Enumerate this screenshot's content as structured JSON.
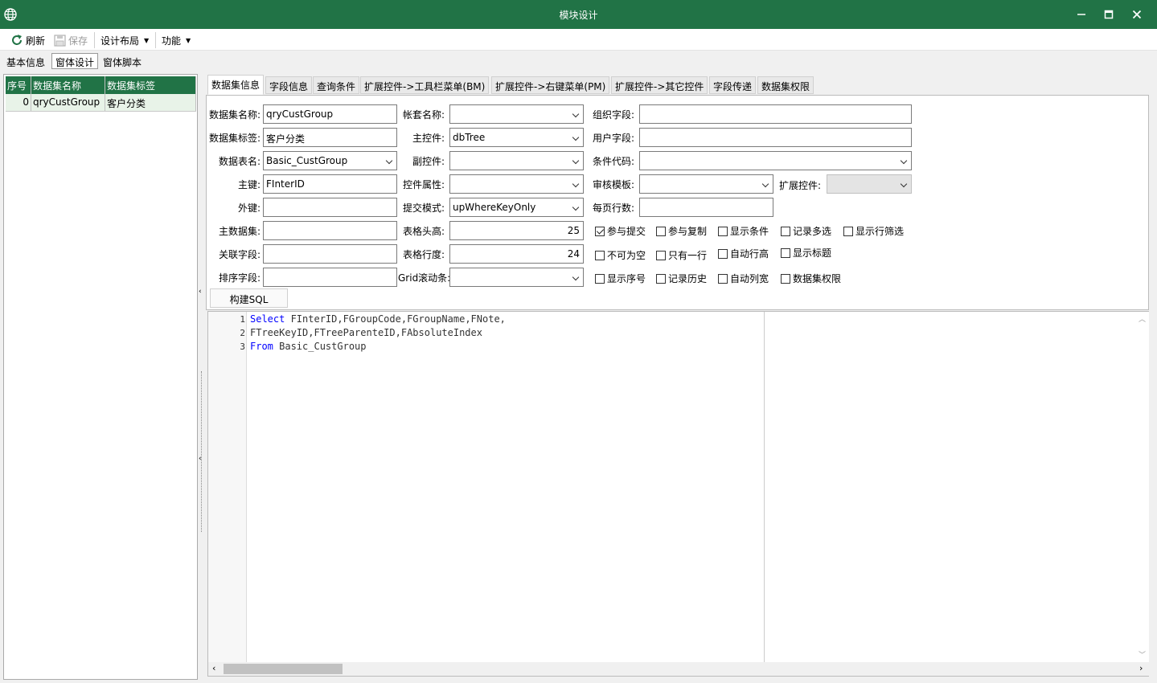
{
  "window": {
    "title": "模块设计",
    "accent": "#217346"
  },
  "toolbar": {
    "refresh": "刷新",
    "save": "保存",
    "layout": "设计布局",
    "functions": "功能"
  },
  "top_tabs": [
    "基本信息",
    "窗体设计",
    "窗体脚本"
  ],
  "left_grid": {
    "headers": [
      "序号",
      "数据集名称",
      "数据集标签"
    ],
    "rows": [
      {
        "idx": "0",
        "name": "qryCustGroup",
        "label": "客户分类"
      }
    ]
  },
  "right_tabs": [
    "数据集信息",
    "字段信息",
    "查询条件",
    "扩展控件->工具栏菜单(BM)",
    "扩展控件->右键菜单(PM)",
    "扩展控件->其它控件",
    "字段传递",
    "数据集权限"
  ],
  "form": {
    "col1": {
      "name_label": "数据集名称:",
      "name_value": "qryCustGroup",
      "tag_label": "数据集标签:",
      "tag_value": "客户分类",
      "table_label": "数据表名:",
      "table_value": "Basic_CustGroup",
      "pk_label": "主键:",
      "pk_value": "FInterID",
      "fk_label": "外键:",
      "fk_value": "",
      "master_label": "主数据集:",
      "master_value": "",
      "link_label": "关联字段:",
      "link_value": "",
      "sort_label": "排序字段:",
      "sort_value": ""
    },
    "col2": {
      "account_label": "帐套名称:",
      "account_value": "",
      "main_ctrl_label": "主控件:",
      "main_ctrl_value": "dbTree",
      "sub_ctrl_label": "副控件:",
      "sub_ctrl_value": "",
      "ctrl_prop_label": "控件属性:",
      "ctrl_prop_value": "",
      "submit_label": "提交模式:",
      "submit_value": "upWhereKeyOnly",
      "header_h_label": "表格头高:",
      "header_h_value": "25",
      "row_h_label": "表格行度:",
      "row_h_value": "24",
      "grid_scroll_label": "Grid滚动条:",
      "grid_scroll_value": ""
    },
    "col3": {
      "org_label": "组织字段:",
      "org_value": "",
      "user_label": "用户字段:",
      "user_value": "",
      "cond_label": "条件代码:",
      "cond_value": "",
      "audit_label": "审核模板:",
      "audit_value": "",
      "ext_label": "扩展控件:",
      "ext_value": "",
      "page_label": "每页行数:",
      "page_value": ""
    },
    "checks": [
      {
        "label": "参与提交",
        "checked": true
      },
      {
        "label": "参与复制",
        "checked": false
      },
      {
        "label": "显示条件",
        "checked": false
      },
      {
        "label": "记录多选",
        "checked": false
      },
      {
        "label": "显示行筛选",
        "checked": false
      },
      {
        "label": "不可为空",
        "checked": false
      },
      {
        "label": "只有一行",
        "checked": false
      },
      {
        "label": "自动行高",
        "checked": false
      },
      {
        "label": "显示标题",
        "checked": false
      },
      {
        "label": "显示序号",
        "checked": false
      },
      {
        "label": "记录历史",
        "checked": false
      },
      {
        "label": "自动列宽",
        "checked": false
      },
      {
        "label": "数据集权限",
        "checked": false
      }
    ],
    "build_sql": "构建SQL"
  },
  "editor": {
    "lines": [
      {
        "no": "1",
        "kw": "Select",
        "rest": " FInterID,FGroupCode,FGroupName,FNote,"
      },
      {
        "no": "2",
        "kw": "",
        "rest": "FTreeKeyID,FTreeParenteID,FAbsoluteIndex"
      },
      {
        "no": "3",
        "kw": "From",
        "rest": " Basic_CustGroup"
      }
    ]
  }
}
